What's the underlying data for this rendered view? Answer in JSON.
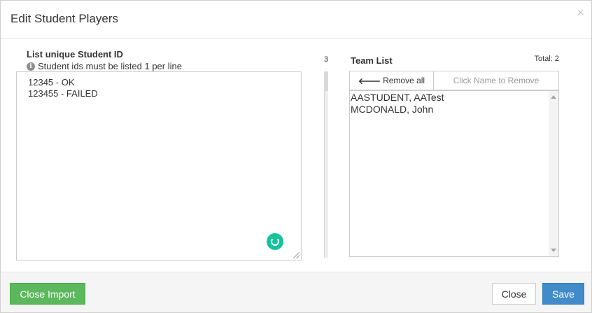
{
  "modal": {
    "title": "Edit Student Players",
    "close_glyph": "×"
  },
  "left": {
    "label": "List unique Student ID",
    "hint": "Student ids must be listed 1 per line",
    "info_icon": "info-circle-icon",
    "textarea_value": "12345 - OK\n123455 - FAILED"
  },
  "middle": {
    "number": "3"
  },
  "team": {
    "label": "Team List",
    "total": "Total: 2",
    "remove_all_arrow": "🡐",
    "remove_all_label": "Remove all",
    "click_name_label": "Click Name to Remove",
    "items": [
      "AASTUDENT, AATest",
      "MCDONALD, John"
    ]
  },
  "footer": {
    "close_import_label": "Close Import",
    "close_label": "Close",
    "save_label": "Save"
  },
  "colors": {
    "success": "#5cb85c",
    "primary": "#428bca",
    "spinner": "#15c39a"
  }
}
